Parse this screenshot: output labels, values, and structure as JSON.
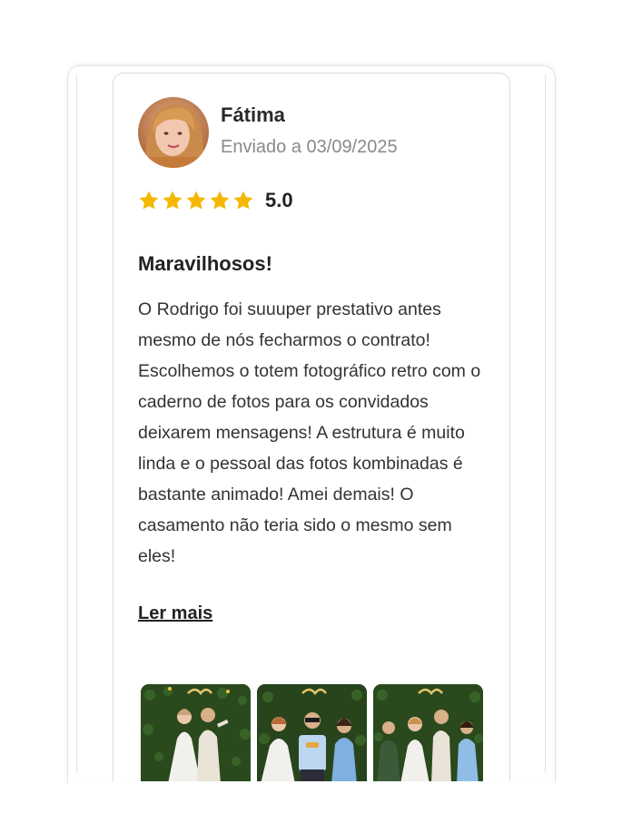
{
  "review": {
    "author": "Fátima",
    "sent_date": "Enviado a 03/09/2025",
    "rating_value": "5.0",
    "stars": 5,
    "title": "Maravilhosos!",
    "body": "O Rodrigo foi suuuper prestativo antes mesmo de nós fecharmos o contrato! Escolhemos o totem fotográfico retro com o caderno de fotos para os convidados deixarem mensagens! A estrutura é muito linda e o pessoal das fotos kombinadas é bastante animado! Amei demais! O casamento não teria sido o mesmo sem eles!",
    "read_more": "Ler mais"
  },
  "colors": {
    "star": "#F5B800",
    "muted_text": "#8a8a8a",
    "hedge_green": "#2a4a1e"
  },
  "photos": [
    {
      "icon": "wedding-photo-1"
    },
    {
      "icon": "wedding-photo-2"
    },
    {
      "icon": "wedding-photo-3"
    }
  ]
}
